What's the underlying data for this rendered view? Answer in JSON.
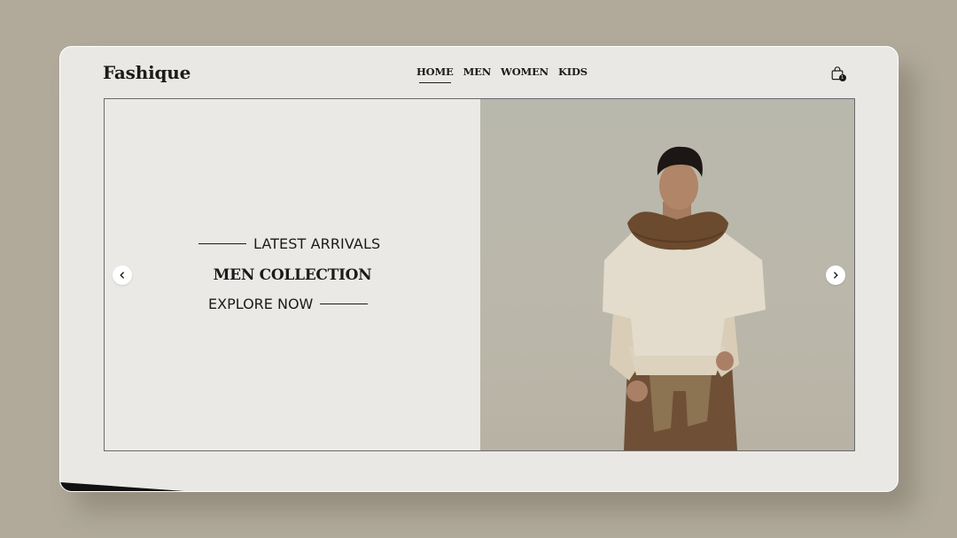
{
  "brand": {
    "logo_text": "Fashique"
  },
  "nav": {
    "items": [
      {
        "label": "HOME",
        "active": true
      },
      {
        "label": "MEN",
        "active": false
      },
      {
        "label": "WOMEN",
        "active": false
      },
      {
        "label": "KIDS",
        "active": false
      }
    ]
  },
  "cart": {
    "icon": "shopping-bag-icon",
    "badge": "1"
  },
  "hero": {
    "tagline": "LATEST ARRIVALS",
    "headline": "MEN COLLECTION",
    "cta": "EXPLORE NOW",
    "prev_icon": "chevron-left-icon",
    "next_icon": "chevron-right-icon",
    "image": "model-photo"
  },
  "colors": {
    "page_background": "#b1aa9b",
    "card_background": "#eae8e4",
    "text": "#1b1b1b",
    "photo_background": "#bbb8ab"
  }
}
